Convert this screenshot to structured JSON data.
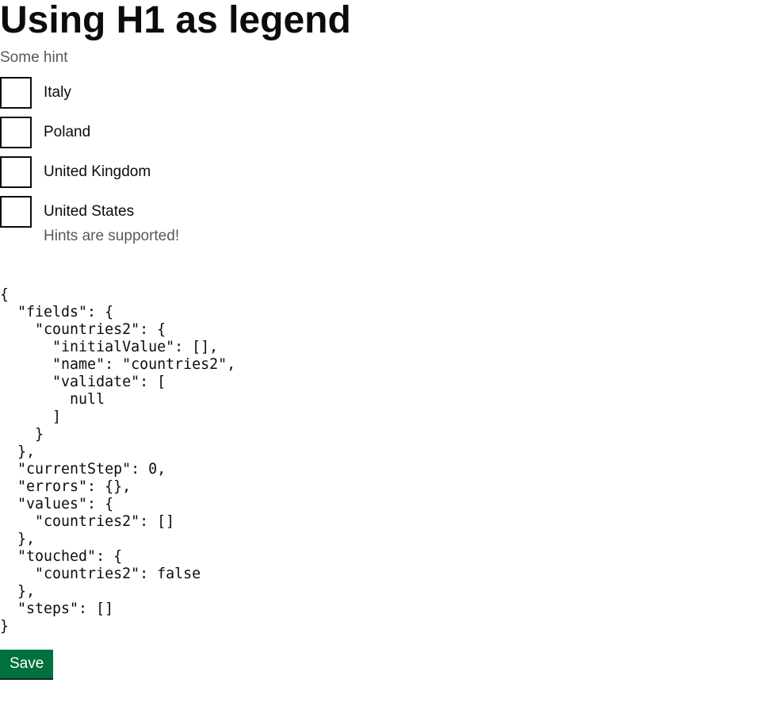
{
  "form": {
    "legend": "Using H1 as legend",
    "hint": "Some hint",
    "options": [
      {
        "label": "Italy",
        "checked": false
      },
      {
        "label": "Poland",
        "checked": false
      },
      {
        "label": "United Kingdom",
        "checked": false
      },
      {
        "label": "United States",
        "checked": false,
        "hint": "Hints are supported!"
      }
    ],
    "save_label": "Save"
  },
  "debug": {
    "state_json": "{\n  \"fields\": {\n    \"countries2\": {\n      \"initialValue\": [],\n      \"name\": \"countries2\",\n      \"validate\": [\n        null\n      ]\n    }\n  },\n  \"currentStep\": 0,\n  \"errors\": {},\n  \"values\": {\n    \"countries2\": []\n  },\n  \"touched\": {\n    \"countries2\": false\n  },\n  \"steps\": []\n}"
  },
  "colors": {
    "button": "#00703c",
    "text": "#0b0c0c",
    "hint": "#505a5f"
  }
}
